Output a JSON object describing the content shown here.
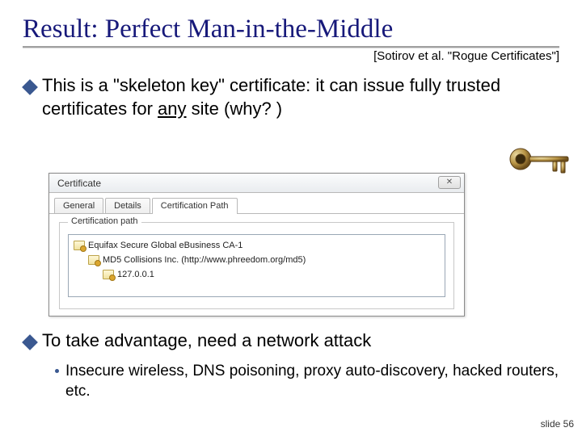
{
  "title": "Result: Perfect Man-in-the-Middle",
  "citation": "[Sotirov et al. \"Rogue Certificates\"]",
  "bullet1_pre": "This is a \"skeleton key\" certificate: it can issue fully trusted certificates for ",
  "bullet1_underline": "any",
  "bullet1_post": " site (why? )",
  "bullet2": "To take advantage, need a network attack",
  "sub_bullet": "Insecure wireless, DNS poisoning, proxy auto-discovery, hacked routers, etc.",
  "cert_window": {
    "title": "Certificate",
    "close": "✕",
    "tabs": {
      "general": "General",
      "details": "Details",
      "path": "Certification Path"
    },
    "legend": "Certification path",
    "tree": {
      "root": "Equifax Secure Global eBusiness CA-1",
      "mid": "MD5 Collisions Inc. (http://www.phreedom.org/md5)",
      "leaf": "127.0.0.1"
    }
  },
  "slide_num": "slide 56"
}
